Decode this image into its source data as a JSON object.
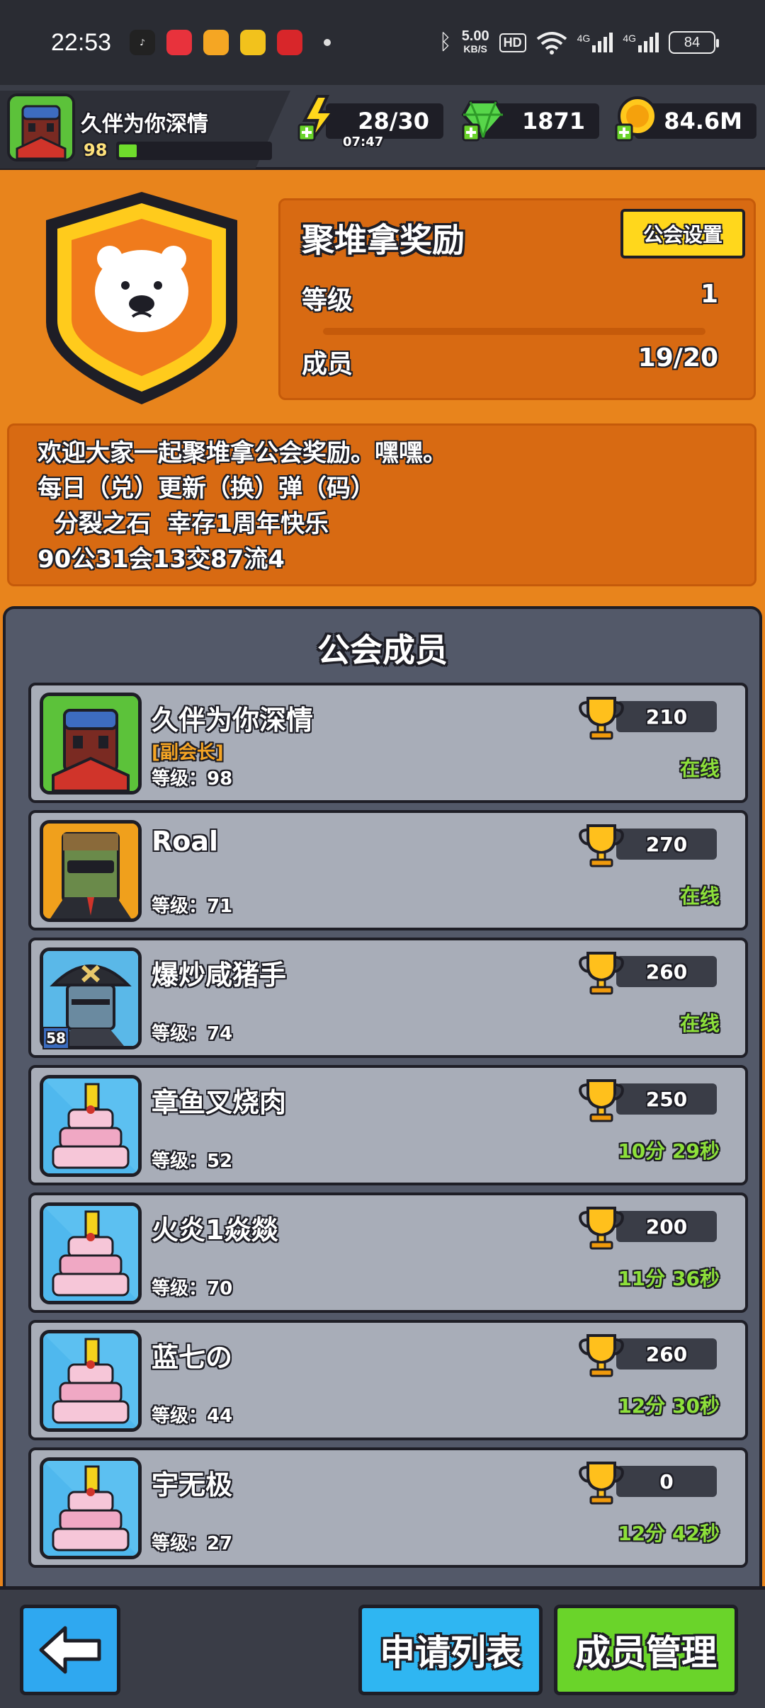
{
  "status_bar": {
    "time": "22:53",
    "speed_value": "5.00",
    "speed_unit": "KB/S",
    "hd": "HD",
    "signal_1": "4G",
    "signal_2": "4G",
    "battery": "84"
  },
  "player": {
    "name": "久伴为你深情",
    "level": "98",
    "xp_fraction": 0.12
  },
  "resources": {
    "energy": "28/30",
    "energy_timer": "07:47",
    "gems": "1871",
    "coins": "84.6M"
  },
  "guild": {
    "name": "聚堆拿奖励",
    "settings_label": "公会设置",
    "level_label": "等级",
    "level_value": "1",
    "members_label": "成员",
    "members_value": "19/20",
    "description_lines": [
      "欢迎大家一起聚堆拿公会奖励。嘿嘿。",
      "每日（兑）更新（换）弹（码）",
      "  分裂之石  幸存1周年快乐",
      "90公31会13交87流4"
    ]
  },
  "members_panel": {
    "title": "公会成员",
    "members": [
      {
        "name": "久伴为你深情",
        "role": "[副会长]",
        "level": "等级：98",
        "score": "210",
        "status": "在线",
        "avatar": "ninja"
      },
      {
        "name": "Roal",
        "role": "",
        "level": "等级：71",
        "score": "270",
        "status": "在线",
        "avatar": "zombie"
      },
      {
        "name": "爆炒咸猪手",
        "role": "",
        "level": "等级：74",
        "score": "260",
        "status": "在线",
        "avatar": "pirate"
      },
      {
        "name": "章鱼叉烧肉",
        "role": "",
        "level": "等级：52",
        "score": "250",
        "status": "10分 29秒",
        "avatar": "cake"
      },
      {
        "name": "火炎1焱燚",
        "role": "",
        "level": "等级：70",
        "score": "200",
        "status": "11分 36秒",
        "avatar": "cake"
      },
      {
        "name": "蓝七の",
        "role": "",
        "level": "等级：44",
        "score": "260",
        "status": "12分 30秒",
        "avatar": "cake"
      },
      {
        "name": "宇无极",
        "role": "",
        "level": "等级：27",
        "score": "0",
        "status": "12分 42秒",
        "avatar": "cake"
      }
    ],
    "pirate_badge": "58"
  },
  "bottom": {
    "apply_list": "申请列表",
    "member_manage": "成员管理"
  },
  "colors": {
    "orange_bg": "#e8841c",
    "panel_gray": "#535969",
    "online_green": "#8de03a",
    "gold": "#ffd71c"
  }
}
